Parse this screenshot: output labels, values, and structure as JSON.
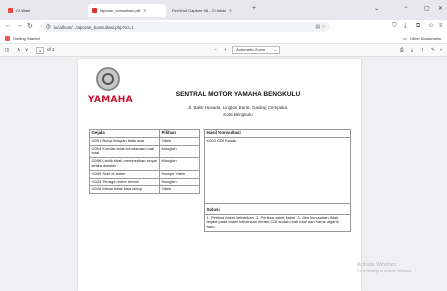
{
  "browser": {
    "tabs": [
      {
        "label": "CI-Wabi",
        "active": false
      },
      {
        "label": "laporan_konsultasi.pdf",
        "active": true
      },
      {
        "label": "FireShot Capture 08 - CI-Wabi",
        "active": false
      }
    ],
    "new_tab": "+",
    "url": "localhost/...laporan_konsultasi.php?id=1",
    "bookmark_left": "Getting Started",
    "bookmark_right": "Other Bookmarks"
  },
  "pdf_toolbar": {
    "page_current": "1",
    "page_total": "of 1",
    "zoom_minus": "−",
    "zoom_plus": "+",
    "zoom_value": "Automatic Zoom"
  },
  "document": {
    "logo_text": "YAMAHA",
    "title": "SENTRAL MOTOR YAMAHA BENGKULU",
    "address_line1": "Jl. Bakti Husada, Lingkar Barat, Gading Cempaka,",
    "address_line2": "Kota Bengkulu",
    "symptoms_table": {
      "headers": [
        "Gejala",
        "Pilihan"
      ],
      "rows": [
        {
          "gejala": "G001 Bunyi letupan tidak ada",
          "pilihan": "Yakin"
        },
        {
          "gejala": "G004 Kondisi telah kendaraan mati total",
          "pilihan": "Mungkin"
        },
        {
          "gejala": "G006 Listrik tidak memberikan sinyal ketika distater",
          "pilihan": "Mungkin"
        },
        {
          "gejala": "G009 Sulit di stater",
          "pilihan": "Hampir Yakin"
        },
        {
          "gejala": "G023 Tenaga motor lemah",
          "pilihan": "Mungkin"
        },
        {
          "gejala": "G026 Mesin tidak bisa hidup",
          "pilihan": "Yakin"
        }
      ]
    },
    "result_table": {
      "header_result": "Hasil Konsultasi",
      "result": "K003 CDI Rusak",
      "header_solution": "Solusi",
      "solution": "1. Periksa kabel kelistrikan. 2. Periksa soket kabel. 3. Jika kerusakan tidak terjadi pada kabel kelistrikan berarti CDI sudah mati total dan harus diganti baru."
    }
  },
  "watermark": {
    "line1": "Activate Windows",
    "line2": "Go to Settings to activate Windows."
  }
}
